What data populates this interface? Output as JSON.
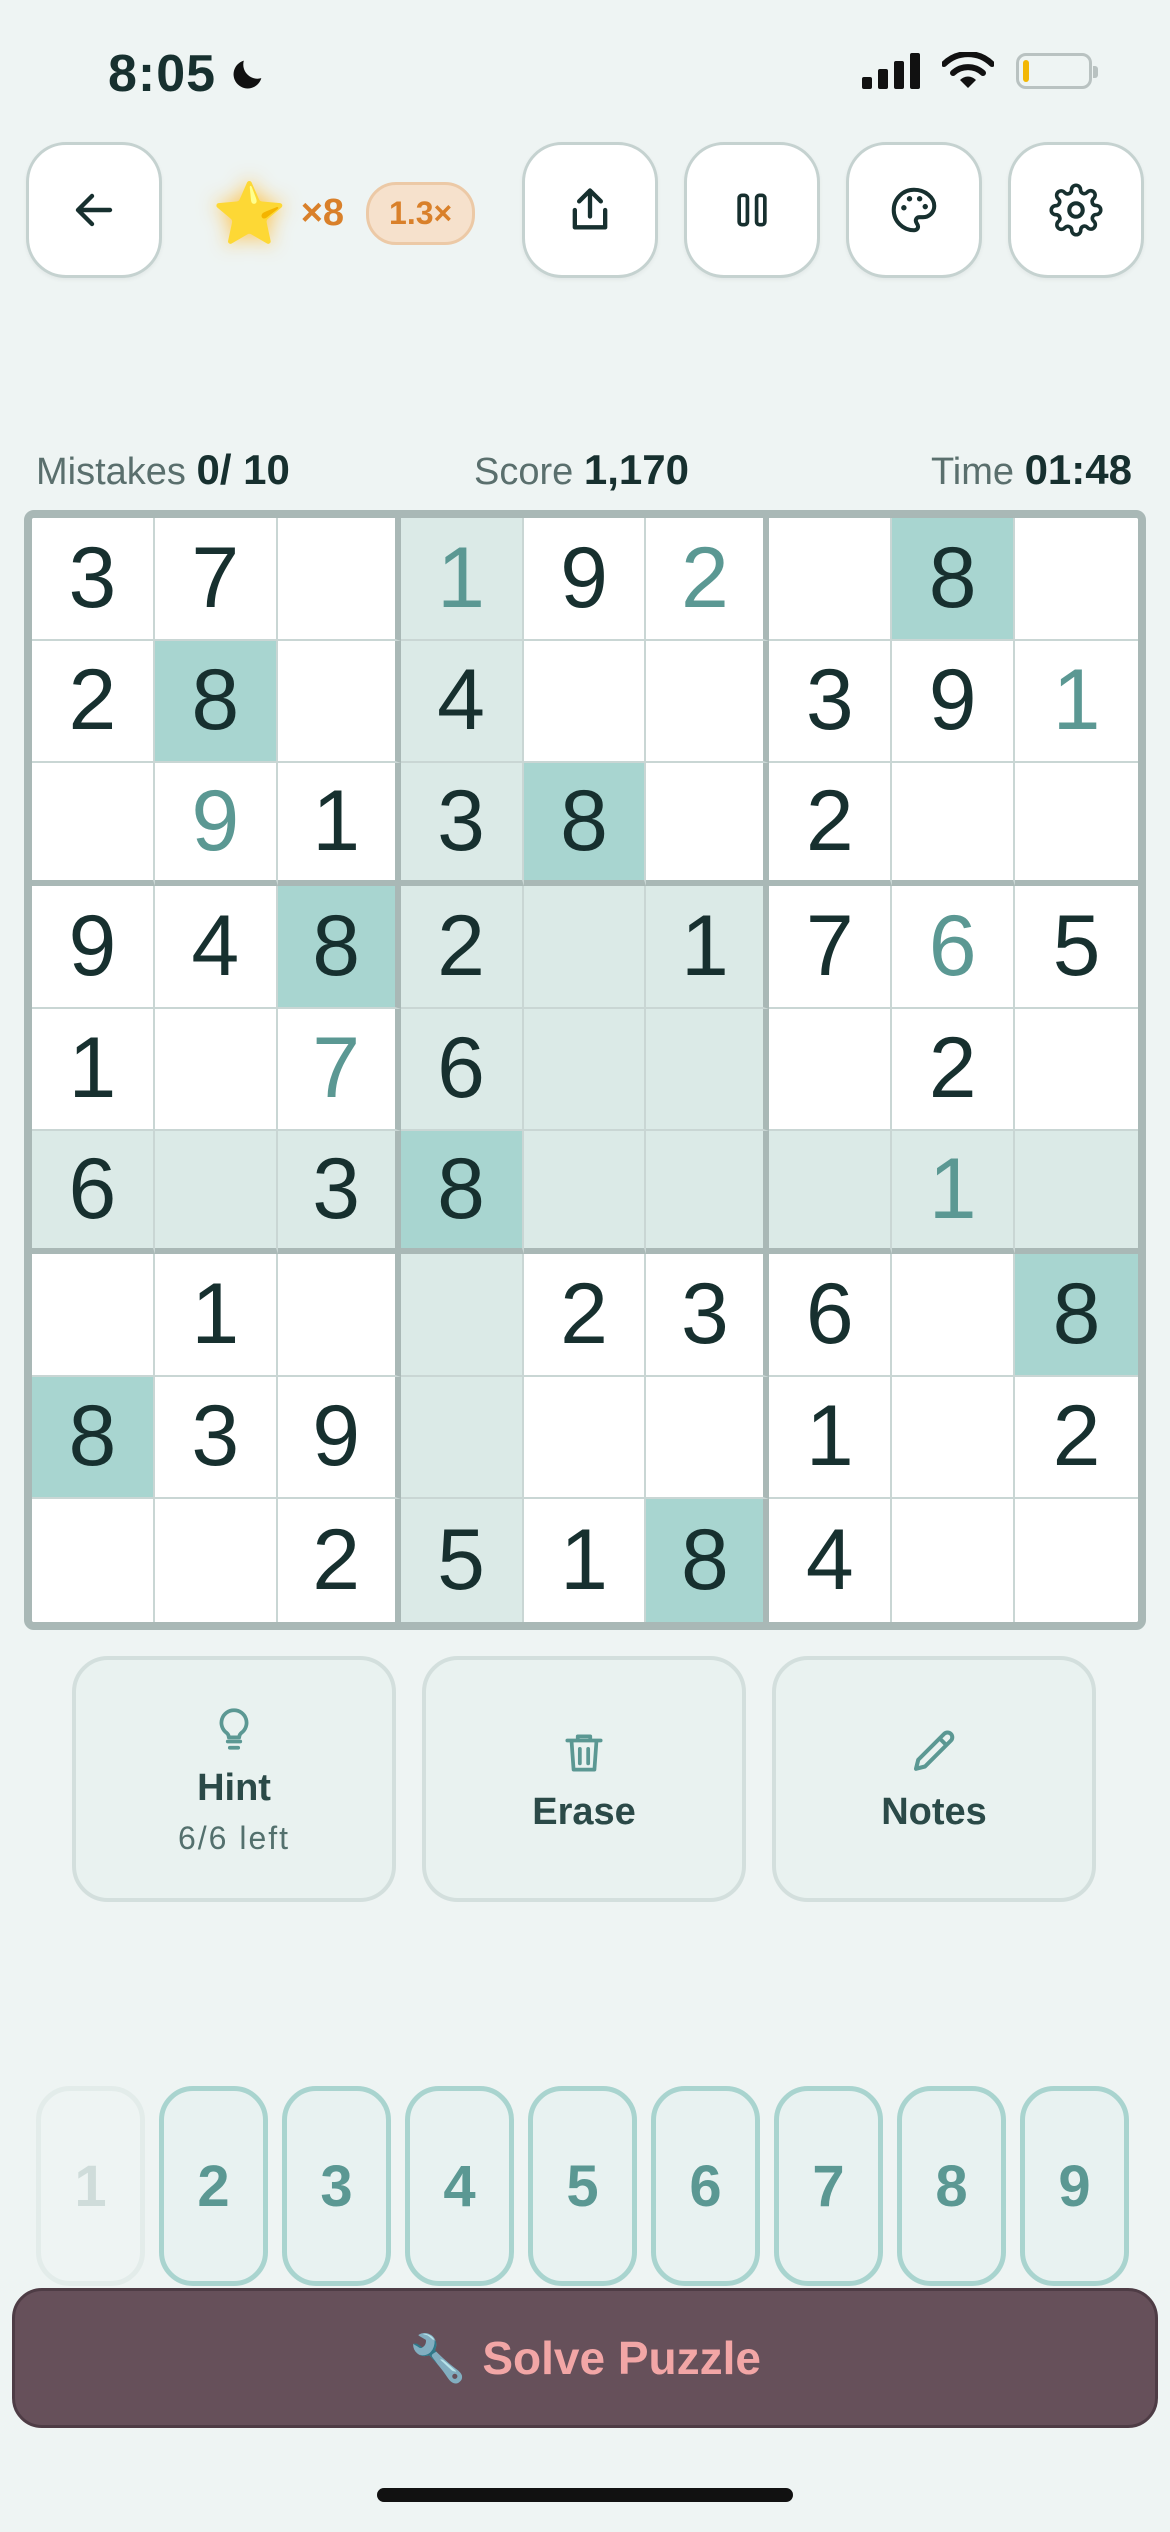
{
  "status": {
    "time": "8:05"
  },
  "topbar": {
    "streak_count": "×8",
    "multiplier": "1.3×"
  },
  "stats": {
    "mistakes_label": "Mistakes",
    "mistakes_value": "0/ 10",
    "score_label": "Score",
    "score_value": "1,170",
    "time_label": "Time",
    "time_value": "01:48"
  },
  "board": {
    "rows": [
      [
        "3",
        "7",
        "",
        "1",
        "9",
        "2",
        "",
        "8",
        ""
      ],
      [
        "2",
        "8",
        "",
        "4",
        "",
        "",
        "3",
        "9",
        "1"
      ],
      [
        "",
        "9",
        "1",
        "3",
        "8",
        "",
        "2",
        "",
        ""
      ],
      [
        "9",
        "4",
        "8",
        "2",
        "",
        "1",
        "7",
        "6",
        "5"
      ],
      [
        "1",
        "",
        "7",
        "6",
        "",
        "",
        "",
        "2",
        ""
      ],
      [
        "6",
        "",
        "3",
        "8",
        "",
        "",
        "",
        "1",
        ""
      ],
      [
        "",
        "1",
        "",
        "",
        "2",
        "3",
        "6",
        "",
        "8"
      ],
      [
        "8",
        "3",
        "9",
        "",
        "",
        "",
        "1",
        "",
        "2"
      ],
      [
        "",
        "",
        "2",
        "5",
        "1",
        "8",
        "4",
        "",
        ""
      ]
    ],
    "user_entries": [
      [
        0,
        3
      ],
      [
        0,
        5
      ],
      [
        1,
        8
      ],
      [
        2,
        1
      ],
      [
        3,
        7
      ],
      [
        4,
        2
      ],
      [
        5,
        7
      ]
    ],
    "same_number_highlight": [
      [
        0,
        7
      ],
      [
        1,
        1
      ],
      [
        2,
        4
      ],
      [
        3,
        2
      ],
      [
        5,
        3
      ],
      [
        6,
        8
      ],
      [
        7,
        0
      ],
      [
        8,
        5
      ]
    ],
    "selected": [
      5,
      3
    ]
  },
  "actions": {
    "hint_label": "Hint",
    "hint_sub": "6/6 left",
    "erase_label": "Erase",
    "notes_label": "Notes"
  },
  "numpad": {
    "keys": [
      "1",
      "2",
      "3",
      "4",
      "5",
      "6",
      "7",
      "8",
      "9"
    ],
    "used": [
      "1"
    ]
  },
  "solve": {
    "icon": "🔧",
    "label": "Solve Puzzle"
  },
  "colors": {
    "accent": "#5b9893",
    "highlight": "#dbeae7",
    "same_number": "#a8d5d0",
    "solve_bg": "#66505a",
    "solve_text": "#f2a6a6",
    "streak_orange": "#d9802a"
  }
}
